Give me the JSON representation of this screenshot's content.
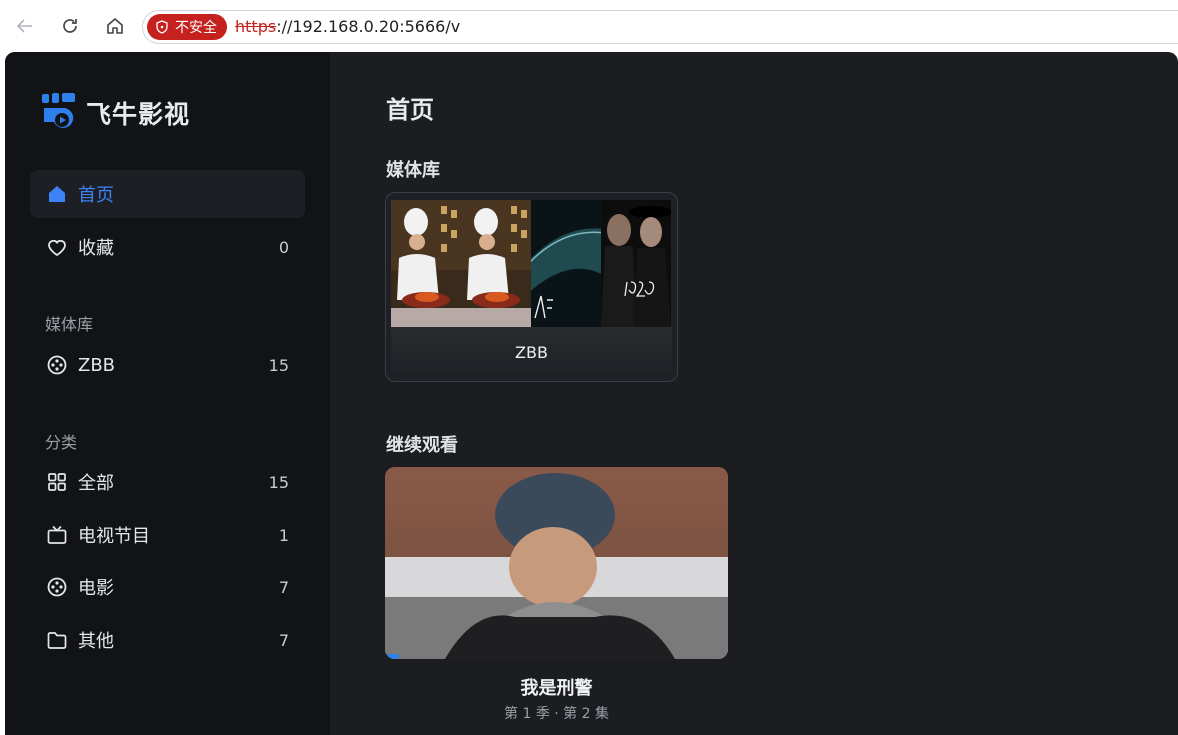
{
  "browser": {
    "security_label": "不安全",
    "url_scheme": "https",
    "url_rest": "://192.168.0.20:5666/v"
  },
  "app": {
    "name": "飞牛影视",
    "accent_color": "#3b82f6"
  },
  "sidebar": {
    "home": {
      "label": "首页",
      "icon": "home-icon",
      "active": true
    },
    "favorites": {
      "label": "收藏",
      "count": "0",
      "icon": "heart-icon"
    },
    "library_section": "媒体库",
    "libraries": [
      {
        "label": "ZBB",
        "count": "15",
        "icon": "film-reel-icon"
      }
    ],
    "category_section": "分类",
    "categories": [
      {
        "label": "全部",
        "count": "15",
        "icon": "grid-icon"
      },
      {
        "label": "电视节目",
        "count": "1",
        "icon": "tv-icon"
      },
      {
        "label": "电影",
        "count": "7",
        "icon": "film-reel-icon"
      },
      {
        "label": "其他",
        "count": "7",
        "icon": "folder-icon"
      }
    ]
  },
  "main": {
    "title": "首页",
    "library_heading": "媒体库",
    "library_card": {
      "name": "ZBB"
    },
    "continue_heading": "继续观看",
    "continue_item": {
      "title": "我是刑警",
      "subtitle": "第 1 季 · 第 2 集",
      "progress": 0.04
    }
  }
}
